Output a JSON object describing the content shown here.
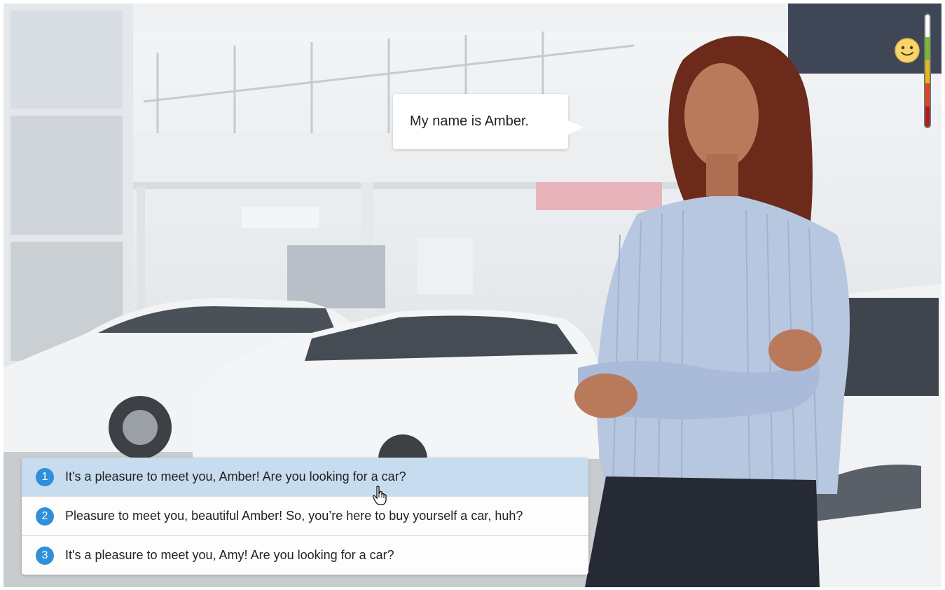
{
  "speech_bubble": {
    "text": "My name is Amber."
  },
  "choices": [
    {
      "number": "1",
      "text": "It's a pleasure to meet you, Amber!  Are you looking for a car?"
    },
    {
      "number": "2",
      "text": "Pleasure to meet you, beautiful Amber! So, you’re here to buy yourself a car, huh?"
    },
    {
      "number": "3",
      "text": "It's a pleasure to meet you, Amy!  Are you looking for a car?"
    }
  ],
  "mood_meter": {
    "level": "green",
    "segments": [
      "empty",
      "green",
      "yellow",
      "red",
      "dark-red"
    ],
    "colors": {
      "green": "#7cbb2e",
      "yellow": "#e6b81b",
      "red": "#e0431f",
      "dark_red": "#b31a1a"
    }
  },
  "mood_icon": "smiley-face-icon",
  "accent_color": "#2f8fd8"
}
